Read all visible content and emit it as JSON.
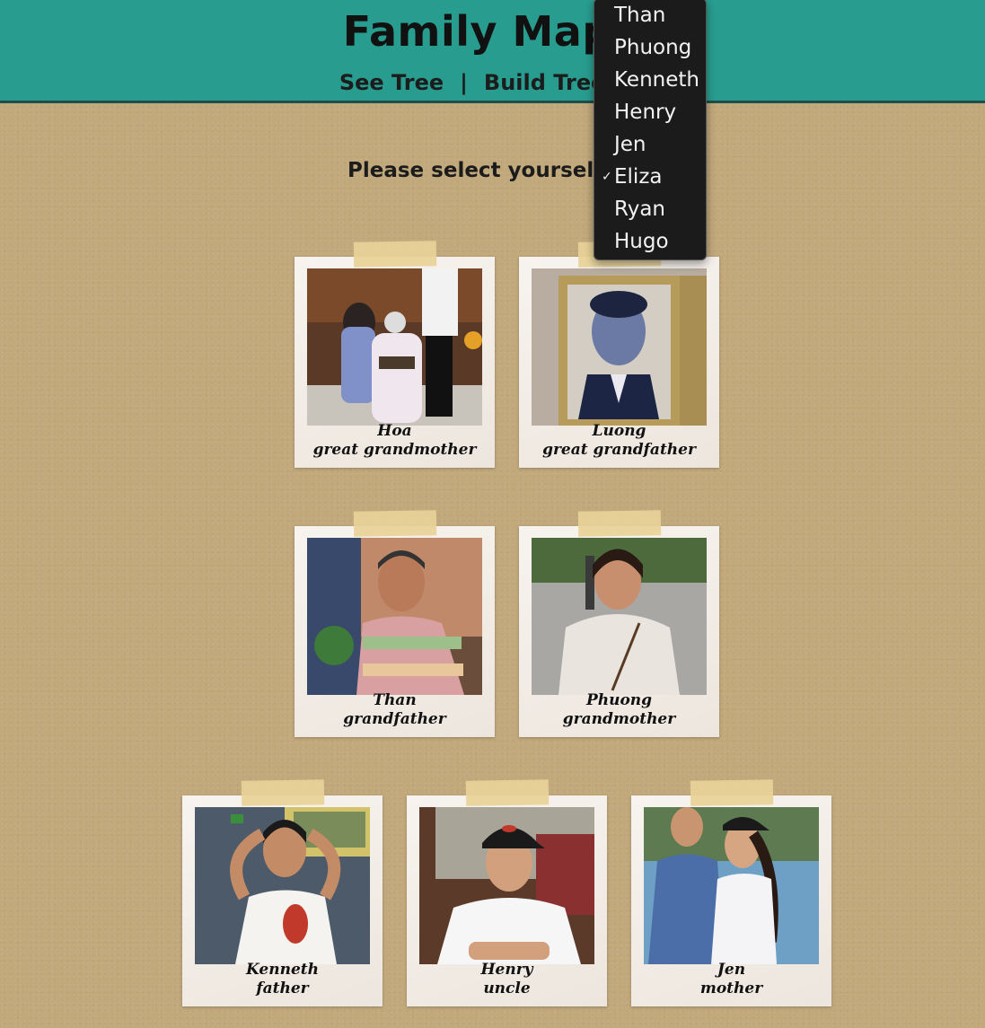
{
  "app": {
    "title": "Family Mapp"
  },
  "nav": {
    "see_tree": "See Tree",
    "separator": "|",
    "build_tree": "Build Tree",
    "separator2": "|"
  },
  "prompt": {
    "label": "Please select yourself"
  },
  "select_menu": {
    "selected": "Eliza",
    "options": [
      "Than",
      "Phuong",
      "Kenneth",
      "Henry",
      "Jen",
      "Eliza",
      "Ryan",
      "Hugo"
    ]
  },
  "members": [
    {
      "name": "Hoa",
      "relation": "great grandmother"
    },
    {
      "name": "Luong",
      "relation": "great grandfather"
    },
    {
      "name": "Than",
      "relation": "grandfather"
    },
    {
      "name": "Phuong",
      "relation": "grandmother"
    },
    {
      "name": "Kenneth",
      "relation": "father"
    },
    {
      "name": "Henry",
      "relation": "uncle"
    },
    {
      "name": "Jen",
      "relation": "mother"
    }
  ]
}
